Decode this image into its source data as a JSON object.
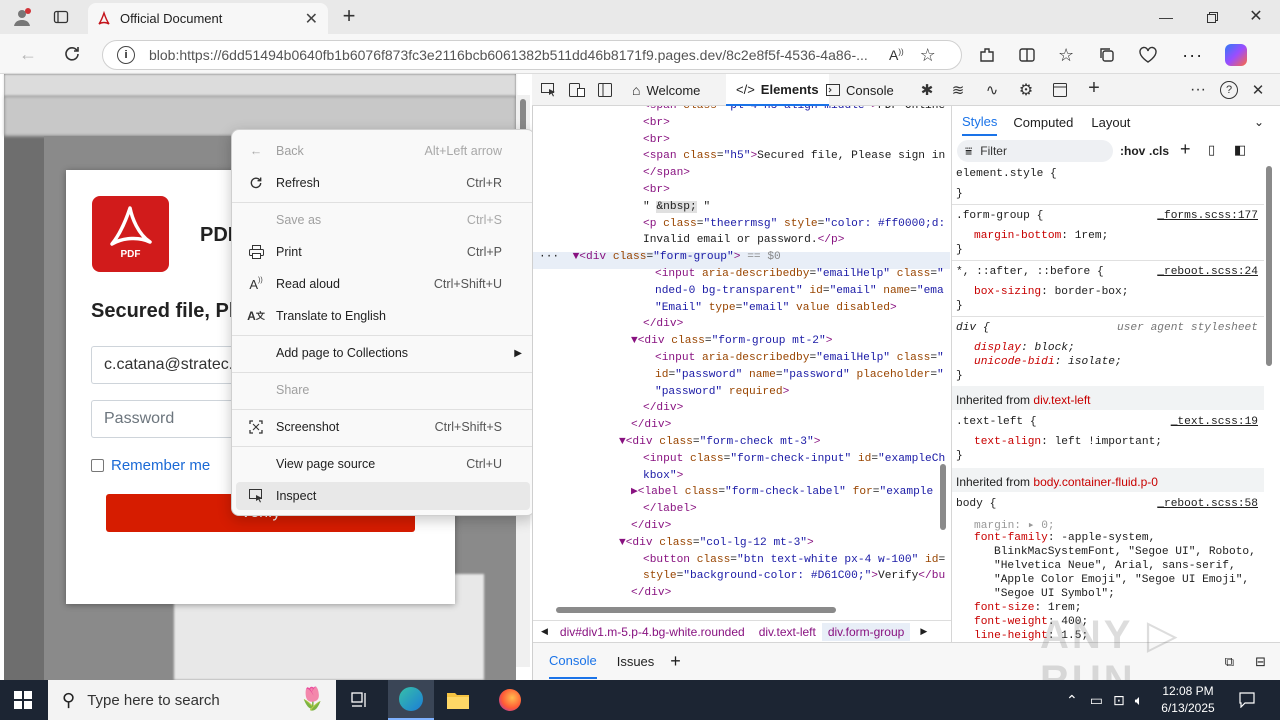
{
  "browser": {
    "tab_title": "Official Document",
    "url": "blob:https://6dd51494b0640fb1b6076f873fc3e2116bcb6061382b511dd46b8171f9.pages.dev/8c2e8f5f-4536-4a86-..."
  },
  "page": {
    "pdf_label": "PDF",
    "heading": "PDF",
    "secured": "Secured file, Ple",
    "email": "c.catana@stratec.c",
    "password_placeholder": "Password",
    "remember": "Remember me",
    "verify": "Verify"
  },
  "menu": {
    "items": [
      {
        "label": "Back",
        "shortcut": "Alt+Left arrow",
        "icon": "back-arrow-icon"
      },
      {
        "label": "Refresh",
        "shortcut": "Ctrl+R",
        "icon": "refresh-icon"
      },
      {
        "label": "Save as",
        "shortcut": "Ctrl+S",
        "icon": ""
      },
      {
        "label": "Print",
        "shortcut": "Ctrl+P",
        "icon": "printer-icon"
      },
      {
        "label": "Read aloud",
        "shortcut": "Ctrl+Shift+U",
        "icon": "read-aloud-icon"
      },
      {
        "label": "Translate to English",
        "shortcut": "",
        "icon": "translate-icon"
      },
      {
        "label": "Add page to Collections",
        "shortcut": "",
        "icon": ""
      },
      {
        "label": "Share",
        "shortcut": "",
        "icon": ""
      },
      {
        "label": "Screenshot",
        "shortcut": "Ctrl+Shift+S",
        "icon": "screenshot-icon"
      },
      {
        "label": "View page source",
        "shortcut": "Ctrl+U",
        "icon": ""
      },
      {
        "label": "Inspect",
        "shortcut": "",
        "icon": "inspect-icon"
      }
    ]
  },
  "devtools": {
    "tabs": {
      "welcome": "Welcome",
      "elements": "Elements",
      "console": "Console"
    },
    "style_tabs": {
      "styles": "Styles",
      "computed": "Computed",
      "layout": "Layout"
    },
    "filter": "Filter",
    "hov": ":hov",
    "cls": ".cls",
    "breadcrumb": {
      "b1": "div#div1.m-5.p-4.bg-white.rounded",
      "b2": "div.text-left",
      "b3": "div.form-group"
    },
    "drawer": {
      "console": "Console",
      "issues": "Issues"
    },
    "inherited1_label": "Inherited from",
    "inherited1_sel": "div.text-left",
    "inherited2_label": "Inherited from",
    "inherited2_sel": "body.container-fluid.p-0",
    "rules": {
      "r1": "element.style {",
      "r1e": "}",
      "r2": ".form-group {",
      "r2s": "_forms.scss:177",
      "r2p": "margin-bottom",
      "r2v": "1rem;",
      "r2e": "}",
      "r3": "*, ::after, ::before {",
      "r3s": "_reboot.scss:24",
      "r3p": "box-sizing",
      "r3v": "border-box;",
      "r3e": "}",
      "r4": "div {",
      "r4s": "user agent stylesheet",
      "r4p1": "display",
      "r4v1": "block;",
      "r4p2": "unicode-bidi",
      "r4v2": "isolate;",
      "r4e": "}",
      "r5": ".text-left {",
      "r5s": "_text.scss:19",
      "r5p": "text-align",
      "r5v": "left !important;",
      "r5e": "}",
      "r6": "body {",
      "r6s": "_reboot.scss:58",
      "r6p1": "margin",
      "r6v1": "0;",
      "r6p2": "font-family",
      "r6v2a": "-apple-system,",
      "r6v2b": "BlinkMacSystemFont, \"Segoe UI\", Roboto,",
      "r6v2c": "\"Helvetica Neue\", Arial, sans-serif,",
      "r6v2d": "\"Apple Color Emoji\", \"Segoe UI Emoji\",",
      "r6v2e": "\"Segoe UI Symbol\";",
      "r6p3": "font-size",
      "r6v3": "1rem;",
      "r6p4": "font-weight",
      "r6v4": "400;",
      "r6p5": "line-height",
      "r6v5": "1.5;"
    }
  },
  "taskbar": {
    "search": "Type here to search",
    "time": "12:08 PM",
    "date": "6/13/2025"
  }
}
